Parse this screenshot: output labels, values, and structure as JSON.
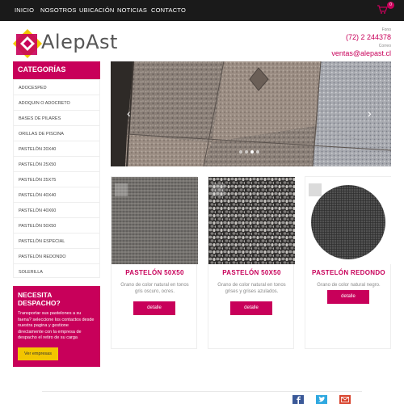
{
  "nav": {
    "items": [
      "INICIO",
      "NOSOTROS",
      "UBICACIÓN",
      "NOTICIAS",
      "CONTACTO"
    ],
    "cart_count": "0"
  },
  "brand": {
    "name": "AlepAst",
    "registered": "®"
  },
  "contact": {
    "phone_label": "Fono",
    "phone": "(72) 2 244378",
    "email_label": "Correo",
    "email": "ventas@alepast.cl"
  },
  "sidebar": {
    "title": "CATEGORÍAS",
    "items": [
      "ADOCESPED",
      "ADOQUIN O ADOCRETO",
      "BASES DE PILARES",
      "ORILLAS DE PISCINA",
      "PASTELÓN 20X40",
      "PASTELÓN 25X50",
      "PASTELÓN 25X75",
      "PASTELÓN 40X40",
      "PASTELÓN 40X60",
      "PASTELÓN 50X50",
      "PASTELÓN ESPECIAL",
      "PASTELÓN REDONDO",
      "SOLERILLA"
    ]
  },
  "despacho": {
    "title": "NECESITA DESPACHO?",
    "text": "Transportar sus pastelones a su faena? seleccione los contactos desde nuestra pagina y gestione directamente con la empresa de despacho el retiro de su carga",
    "button": "Ver empresas"
  },
  "slider": {
    "prev": "‹",
    "next": "›",
    "active_dot": 2
  },
  "products": [
    {
      "title": "PASTELÓN 50X50",
      "desc": "Grano de color natural en tonos gris oscuro, ocres.",
      "button": "detalle"
    },
    {
      "title": "PASTELÓN 50X50",
      "desc": "Grano de color natural en tonos grises y grises azulados.",
      "button": "detalle"
    },
    {
      "title": "PASTELÓN REDONDO",
      "desc": "Grano de color natural negro.",
      "button": "detalle"
    }
  ],
  "colors": {
    "accent": "#c8005a",
    "nav_bg": "#1a1a1a",
    "button_yellow": "#f2c500"
  },
  "footer": {
    "social": [
      "facebook-icon",
      "twitter-icon",
      "email-icon"
    ]
  }
}
